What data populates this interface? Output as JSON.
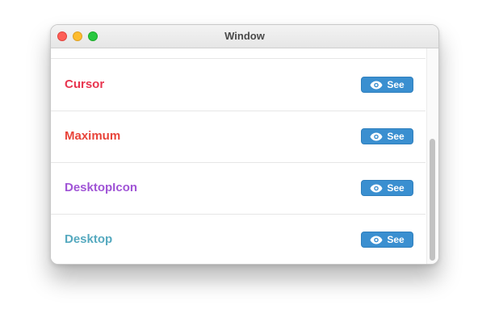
{
  "window": {
    "title": "Window"
  },
  "rows": [
    {
      "label": "Cursor",
      "color": "#e8354f",
      "button_label": "See",
      "button_icon": "eye-icon"
    },
    {
      "label": "Maximum",
      "color": "#e8443a",
      "button_label": "See",
      "button_icon": "eye-icon"
    },
    {
      "label": "DesktopIcon",
      "color": "#a054d6",
      "button_label": "See",
      "button_icon": "eye-icon"
    },
    {
      "label": "Desktop",
      "color": "#55a9bf",
      "button_label": "See",
      "button_icon": "eye-icon"
    }
  ],
  "colors": {
    "button_bg": "#3a8fd0"
  }
}
